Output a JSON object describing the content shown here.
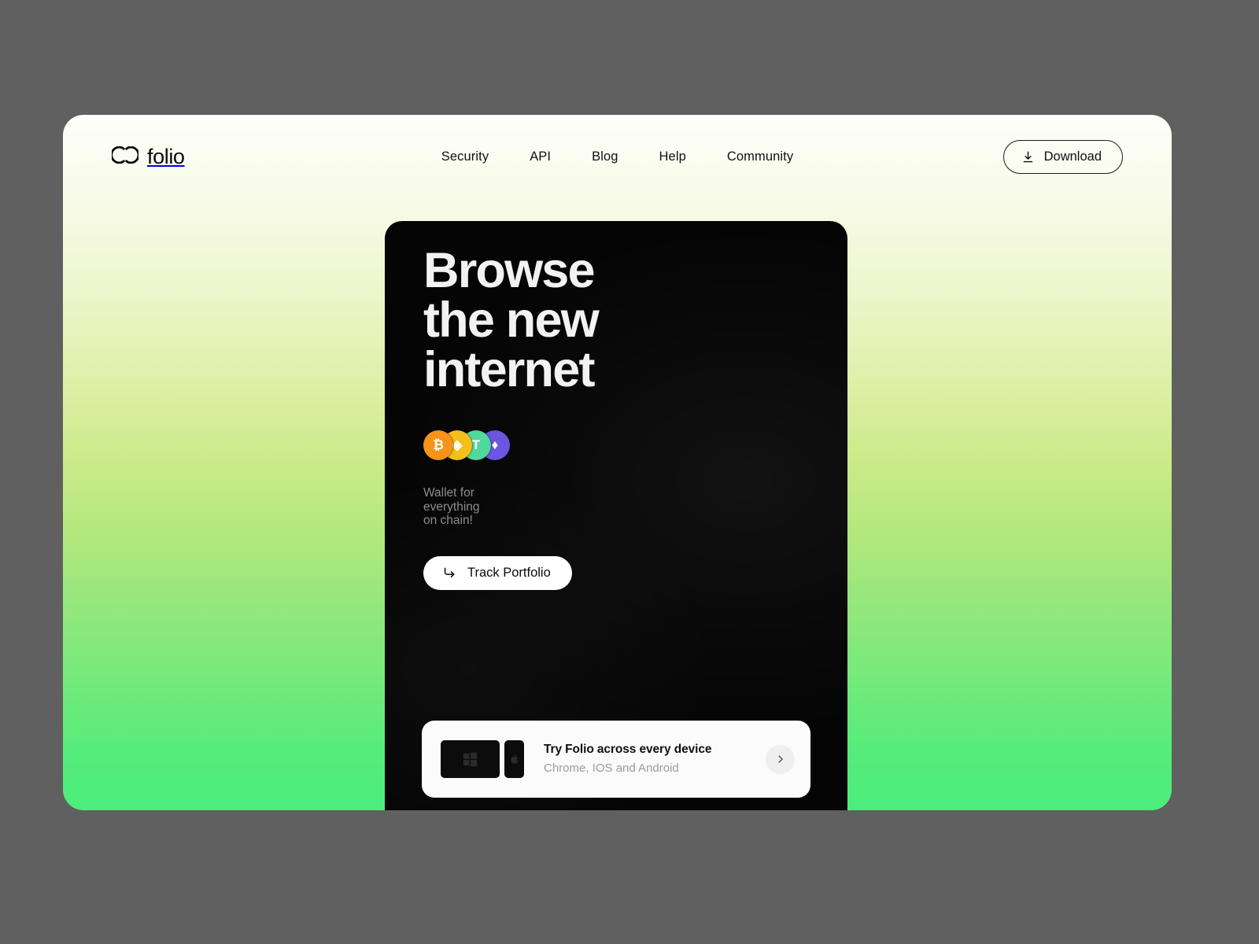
{
  "theme": {
    "outer_background": "#606060",
    "gradient_top": "#fdfffa",
    "gradient_bottom": "#4bed7c",
    "hero_card_background": "#050505",
    "hero_text": "#f2f2f2"
  },
  "header": {
    "brand": {
      "name": "folio",
      "logo_icon": "chain-link-icon"
    },
    "nav": [
      {
        "label": "Security"
      },
      {
        "label": "API"
      },
      {
        "label": "Blog"
      },
      {
        "label": "Help"
      },
      {
        "label": "Community"
      }
    ],
    "download_button": {
      "label": "Download",
      "icon": "download-icon"
    }
  },
  "hero": {
    "title_lines": [
      "Browse",
      "the new",
      "internet"
    ],
    "coins": [
      {
        "name": "bitcoin",
        "symbol": "₿",
        "color": "#F7931A"
      },
      {
        "name": "binance-coin",
        "symbol": "◈",
        "color": "#F3C019"
      },
      {
        "name": "tether",
        "symbol": "T",
        "color": "#4FD99B"
      },
      {
        "name": "ethereum",
        "symbol": "♦",
        "color": "#6C55E0"
      }
    ],
    "subtitle_lines": [
      "Wallet for",
      "everything",
      "on chain!"
    ],
    "cta": {
      "label": "Track Portfolio",
      "icon": "arrow-turn-down-right-icon"
    }
  },
  "device_card": {
    "title": "Try Folio across every device",
    "subtitle": "Chrome, IOS and Android",
    "thumbnails": [
      {
        "name": "desktop-thumbnail",
        "icon": "windows-logo-icon"
      },
      {
        "name": "phone-thumbnail",
        "icon": "apple-logo-icon"
      }
    ],
    "next_button_icon": "chevron-right-icon"
  }
}
